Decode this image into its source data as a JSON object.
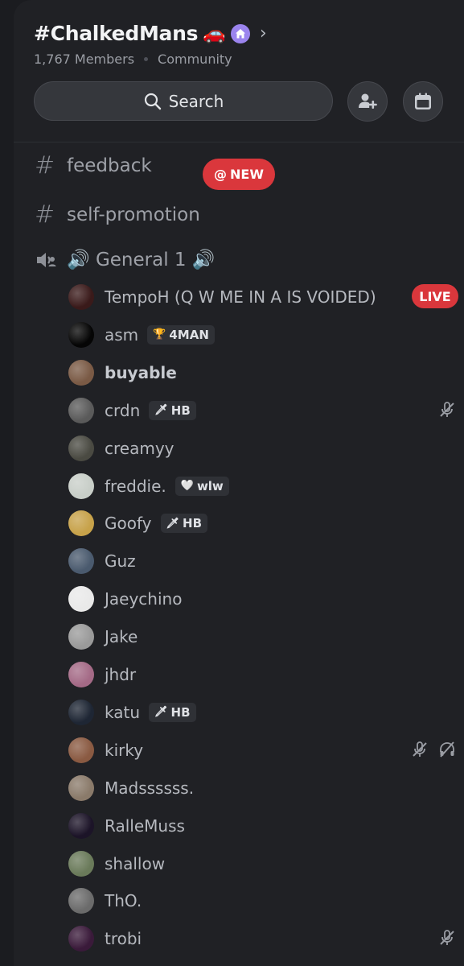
{
  "server": {
    "name": "#ChalkedMans",
    "emoji": "🚗",
    "members": "1,767 Members",
    "type": "Community"
  },
  "search": {
    "label": "Search"
  },
  "icons": {
    "search": "search-icon",
    "invite": "add-member-icon",
    "events": "calendar-icon",
    "community": "home-icon",
    "voice": "voice-channel-icon",
    "muted": "mic-muted-icon",
    "deafened": "headphones-deafened-icon"
  },
  "colors": {
    "accent_red": "#da373c",
    "community_purple": "#9b84ee",
    "bg": "#202125"
  },
  "channels": [
    {
      "name": "feedback",
      "badge_at": "@",
      "badge": "NEW"
    },
    {
      "name": "self-promotion"
    }
  ],
  "voice_channel": {
    "name": "🔊 General 1 🔊"
  },
  "members": [
    {
      "name": "TempoH (Q W ME IN A IS VOIDED)",
      "live": "LIVE",
      "avatar": "#3a1a1a"
    },
    {
      "name": "asm",
      "tag_icon": "🏆",
      "tag": "4MAN",
      "avatar": "#050505"
    },
    {
      "name": "buyable",
      "bold": true,
      "avatar": "#7a5a45"
    },
    {
      "name": "crdn",
      "tag_icon": "🗡",
      "tag": "HB",
      "muted": true,
      "avatar": "#5a5a5a"
    },
    {
      "name": "creamyy",
      "avatar": "#4a4a42"
    },
    {
      "name": "freddie.",
      "tag_icon": "🤍",
      "tag": "wlw",
      "avatar": "#c8cec8"
    },
    {
      "name": "Goofy",
      "tag_icon": "🗡",
      "tag": "HB",
      "avatar": "#c7a24a"
    },
    {
      "name": "Guz",
      "avatar": "#4a5a6e"
    },
    {
      "name": "Jaeychino",
      "avatar": "#e9e9e9"
    },
    {
      "name": "Jake",
      "avatar": "#9a9a9a"
    },
    {
      "name": "jhdr",
      "avatar": "#a46a86"
    },
    {
      "name": "katu",
      "tag_icon": "🗡",
      "tag": "HB",
      "avatar": "#1e2634"
    },
    {
      "name": "kirky",
      "muted": true,
      "deafened": true,
      "avatar": "#8a5a42"
    },
    {
      "name": "Madssssss.",
      "avatar": "#8a7a6a"
    },
    {
      "name": "RalleMuss",
      "avatar": "#1c1428"
    },
    {
      "name": "shallow",
      "avatar": "#6a7a5a"
    },
    {
      "name": "ThO.",
      "avatar": "#6b6b6b"
    },
    {
      "name": "trobi",
      "muted": true,
      "avatar": "#3a1a3a"
    }
  ]
}
